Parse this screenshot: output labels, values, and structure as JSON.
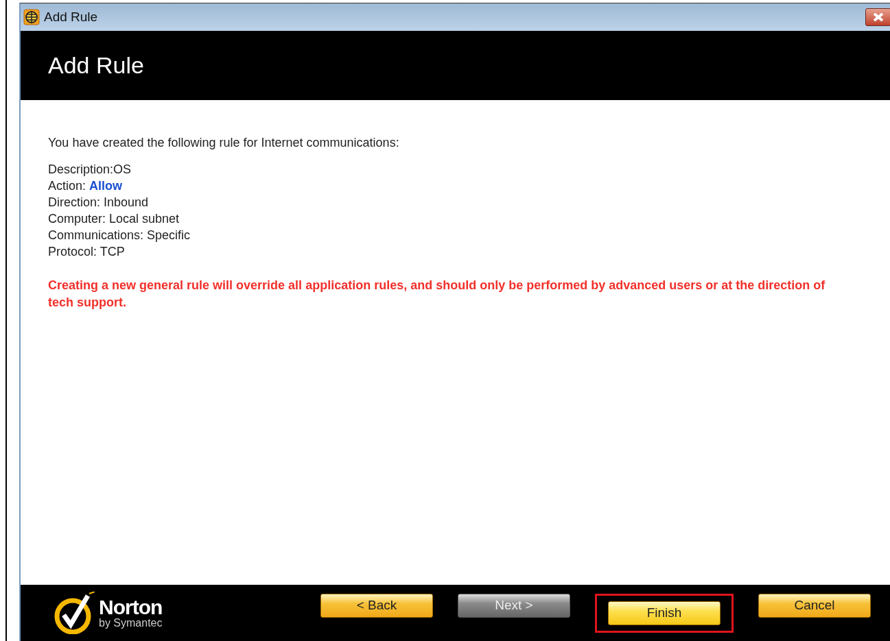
{
  "window": {
    "title": "Add Rule"
  },
  "header": {
    "title": "Add Rule"
  },
  "intro": "You have created the following rule for Internet communications:",
  "details": [
    "Description:OS",
    "Action: **Allow**",
    "Direction: Inbound",
    "Computer: Local subnet",
    "Communications: Specific",
    "Protocol: TCP"
  ],
  "warning": "Creating a new general rule will override all application rules, and should only be performed by advanced users or at the direction of tech support.",
  "logo": {
    "name": "Norton",
    "tagline": "by Symantec"
  },
  "buttons": [
    {
      "label": "< Back",
      "disabled": false,
      "default": false,
      "highlighted": false
    },
    {
      "label": "Next >",
      "disabled": true,
      "default": false,
      "highlighted": false
    },
    {
      "label": "Finish",
      "disabled": false,
      "default": true,
      "highlighted": true
    },
    {
      "label": "Cancel",
      "disabled": false,
      "default": false,
      "highlighted": false
    }
  ]
}
